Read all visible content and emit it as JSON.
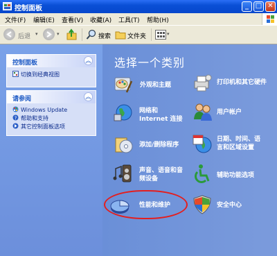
{
  "window": {
    "title": "控制面板",
    "minimize": "_",
    "maximize": "□",
    "close": "✕"
  },
  "menu": [
    "文件(F)",
    "编辑(E)",
    "查看(V)",
    "收藏(A)",
    "工具(T)",
    "帮助(H)"
  ],
  "toolbar": {
    "back": "后退",
    "search": "搜索",
    "folders": "文件夹"
  },
  "left": {
    "panel1": {
      "title": "控制面板",
      "link": "切换到经典视图"
    },
    "panel2": {
      "title": "请参阅",
      "links": [
        "Windows Update",
        "帮助和支持",
        "其它控制面板选项"
      ]
    }
  },
  "main": {
    "heading": "选择一个类别",
    "categories": [
      [
        "外观和主题"
      ],
      [
        "打印机和其它硬件"
      ],
      [
        "网络和",
        "Internet 连接"
      ],
      [
        "用户帐户"
      ],
      [
        "添加/删除程序"
      ],
      [
        "日期、时间、语",
        "言和区域设置"
      ],
      [
        "声音、语音和音",
        "频设备"
      ],
      [
        "辅助功能选项"
      ],
      [
        "性能和维护"
      ],
      [
        "安全中心"
      ]
    ]
  },
  "colors": {
    "titlebar": "#0a4fd6",
    "pane": "#7b9bd9",
    "highlight": "#e41e1e"
  }
}
